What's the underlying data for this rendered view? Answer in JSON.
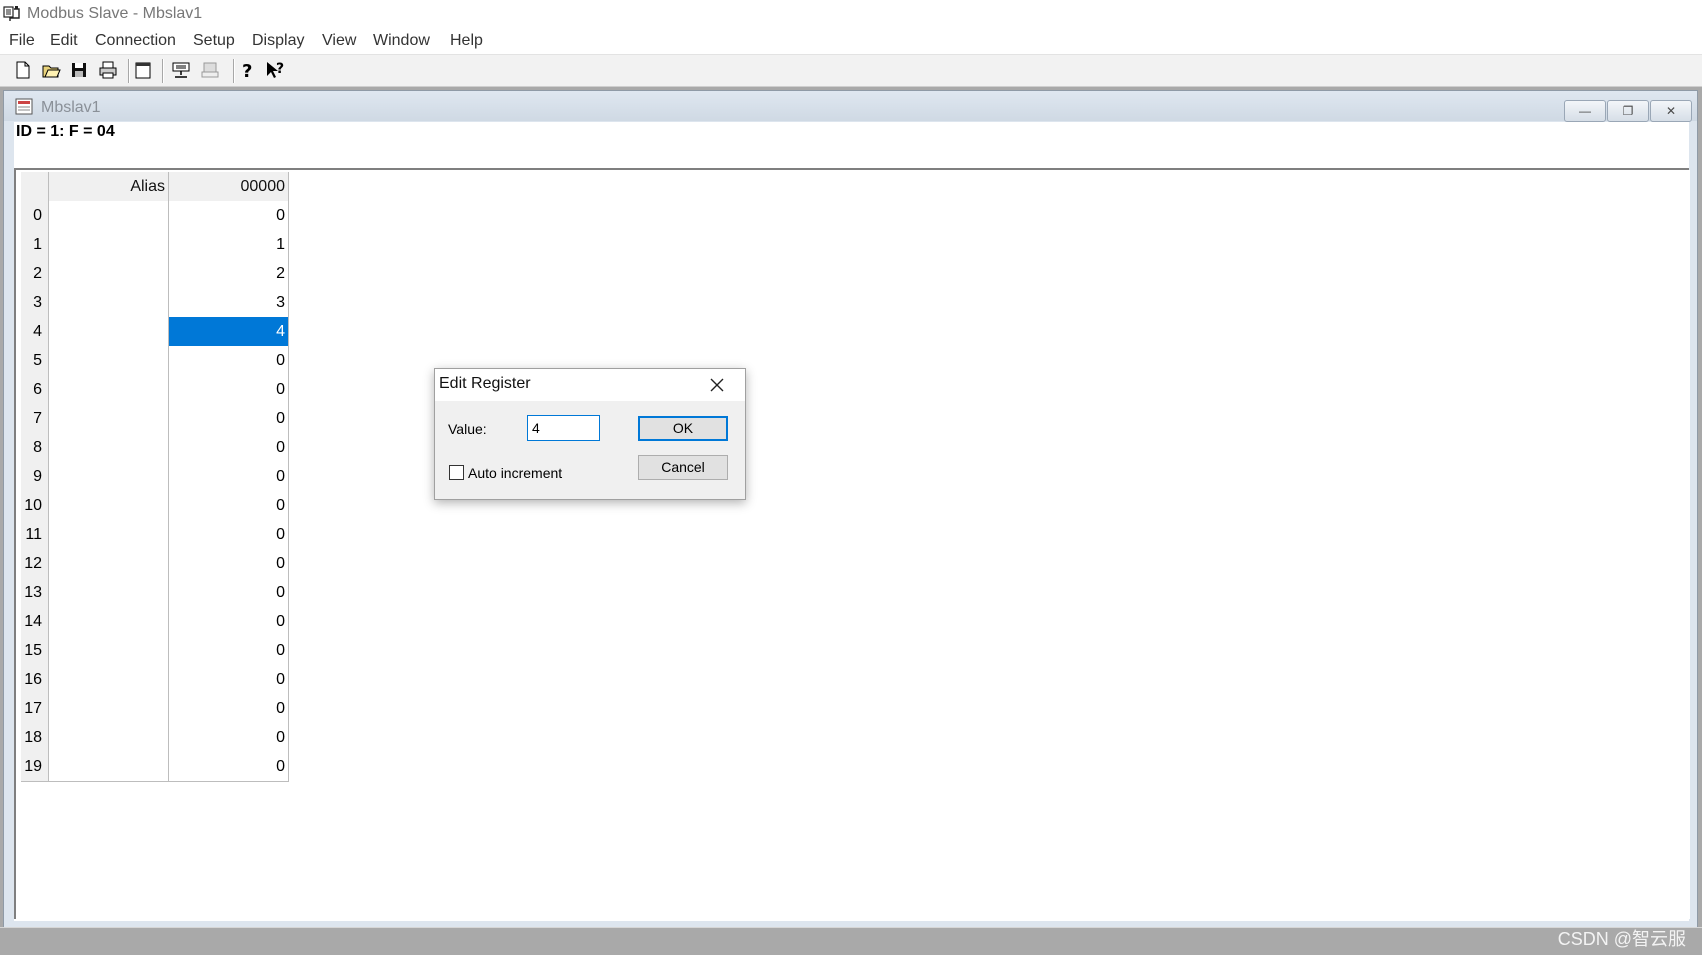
{
  "window": {
    "title": "Modbus Slave - Mbslav1"
  },
  "menu": [
    "File",
    "Edit",
    "Connection",
    "Setup",
    "Display",
    "View",
    "Window",
    "Help"
  ],
  "toolbar": [
    {
      "name": "new-document-icon"
    },
    {
      "name": "open-folder-icon"
    },
    {
      "name": "save-icon"
    },
    {
      "name": "print-icon"
    },
    {
      "name": "new-window-icon"
    },
    {
      "name": "connect-icon"
    },
    {
      "name": "disconnect-icon"
    },
    {
      "name": "help-icon"
    },
    {
      "name": "context-help-icon"
    }
  ],
  "child_window": {
    "title": "Mbslav1",
    "info": "ID = 1: F = 04",
    "buttons": {
      "minimize": "—",
      "restore": "❐",
      "close": "✕"
    }
  },
  "grid": {
    "headers": {
      "alias": "Alias",
      "address": "00000"
    },
    "rows": [
      {
        "n": "0",
        "alias": "",
        "value": "0"
      },
      {
        "n": "1",
        "alias": "",
        "value": "1"
      },
      {
        "n": "2",
        "alias": "",
        "value": "2"
      },
      {
        "n": "3",
        "alias": "",
        "value": "3"
      },
      {
        "n": "4",
        "alias": "",
        "value": "4",
        "selected": true
      },
      {
        "n": "5",
        "alias": "",
        "value": "0"
      },
      {
        "n": "6",
        "alias": "",
        "value": "0"
      },
      {
        "n": "7",
        "alias": "",
        "value": "0"
      },
      {
        "n": "8",
        "alias": "",
        "value": "0"
      },
      {
        "n": "9",
        "alias": "",
        "value": "0"
      },
      {
        "n": "10",
        "alias": "",
        "value": "0"
      },
      {
        "n": "11",
        "alias": "",
        "value": "0"
      },
      {
        "n": "12",
        "alias": "",
        "value": "0"
      },
      {
        "n": "13",
        "alias": "",
        "value": "0"
      },
      {
        "n": "14",
        "alias": "",
        "value": "0"
      },
      {
        "n": "15",
        "alias": "",
        "value": "0"
      },
      {
        "n": "16",
        "alias": "",
        "value": "0"
      },
      {
        "n": "17",
        "alias": "",
        "value": "0"
      },
      {
        "n": "18",
        "alias": "",
        "value": "0"
      },
      {
        "n": "19",
        "alias": "",
        "value": "0"
      }
    ]
  },
  "dialog": {
    "title": "Edit Register",
    "value_label": "Value:",
    "value": "4",
    "ok_label": "OK",
    "cancel_label": "Cancel",
    "auto_increment_label": "Auto increment",
    "auto_increment_checked": false
  },
  "watermark": "CSDN @智云服",
  "colors": {
    "selection": "#0078d7",
    "mdi_background": "#a9a9a9"
  }
}
